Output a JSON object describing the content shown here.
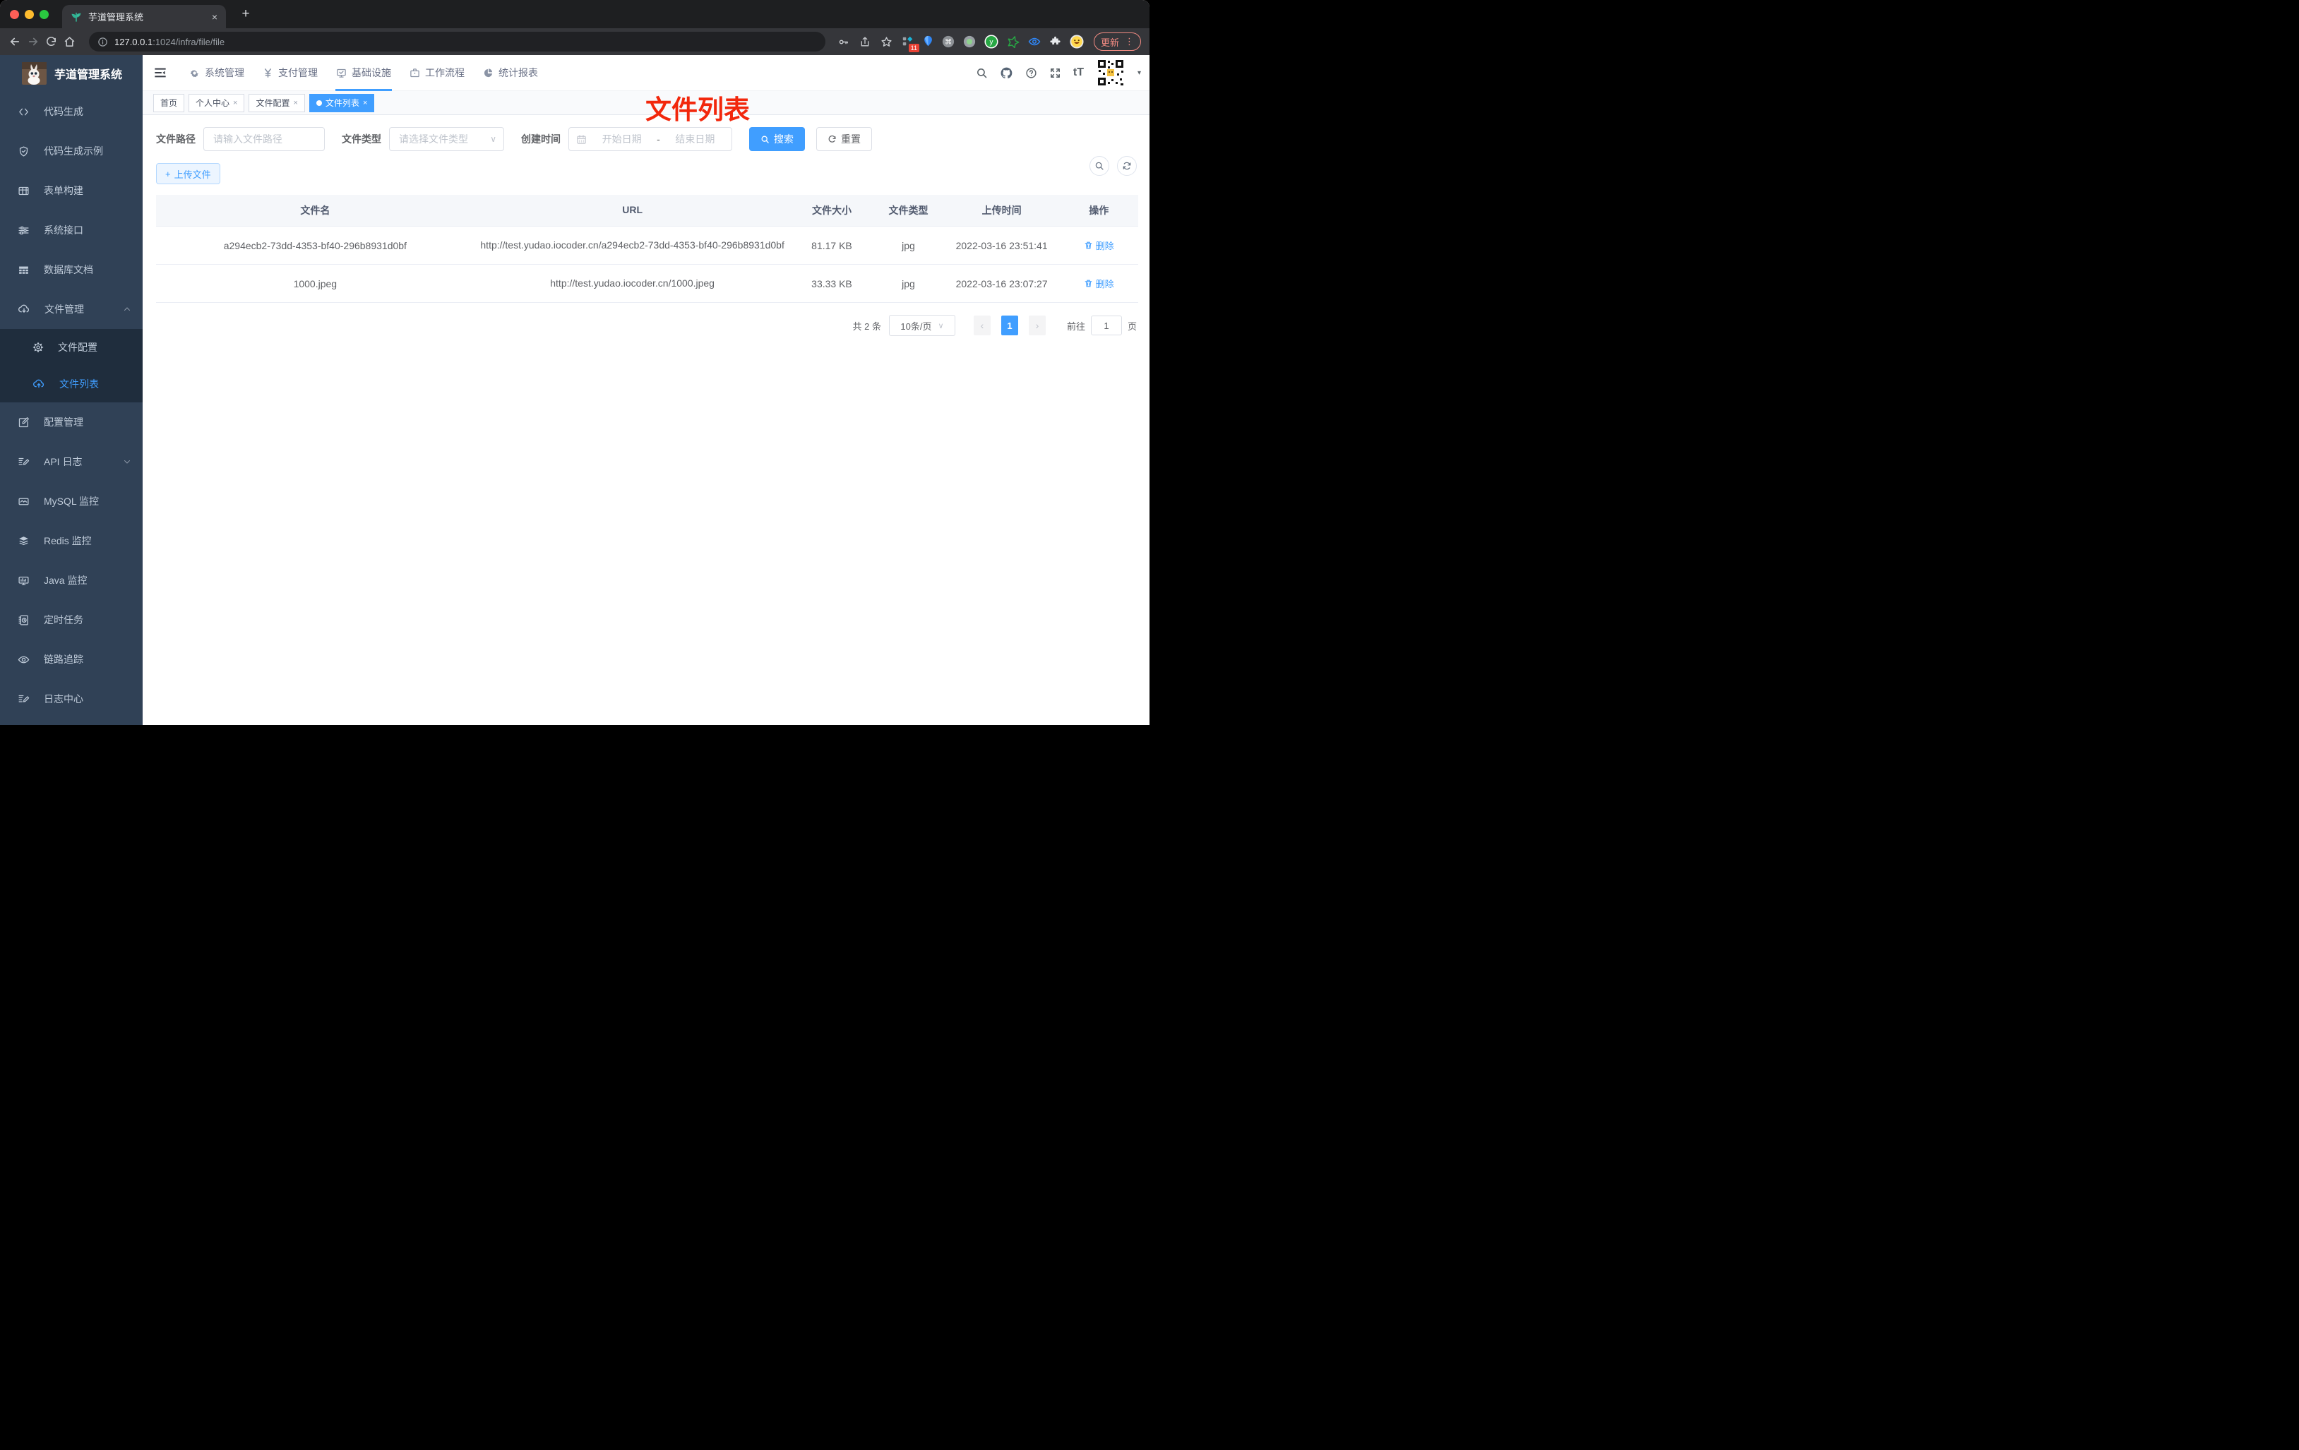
{
  "colors": {
    "accent": "#409eff",
    "annotation_red": "#f2270c",
    "update_pink": "#f28b82",
    "sidebar_bg": "#304156",
    "submenu_bg": "#1f2d3d"
  },
  "icons": {
    "close": "×",
    "plus": "+",
    "ellipsis": "⋮",
    "caret_down": "▾",
    "chevron_down": "∨",
    "chevron_up": "∧",
    "dash": "-",
    "prev": "‹",
    "next": "›",
    "font_size": "tT",
    "cmd": "⌘",
    "y_letter": "y"
  },
  "browser": {
    "tab_title": "芋道管理系统",
    "url_host": "127.0.0.1",
    "url_rest": ":1024/infra/file/file",
    "update_label": "更新",
    "extension_badge": "11"
  },
  "sidebar": {
    "logo_title": "芋道管理系统",
    "items": [
      {
        "label": "代码生成"
      },
      {
        "label": "代码生成示例"
      },
      {
        "label": "表单构建"
      },
      {
        "label": "系统接口"
      },
      {
        "label": "数据库文档"
      },
      {
        "label": "文件管理"
      },
      {
        "label": "文件配置"
      },
      {
        "label": "文件列表"
      },
      {
        "label": "配置管理"
      },
      {
        "label": "API 日志"
      },
      {
        "label": "MySQL 监控"
      },
      {
        "label": "Redis 监控"
      },
      {
        "label": "Java 监控"
      },
      {
        "label": "定时任务"
      },
      {
        "label": "链路追踪"
      },
      {
        "label": "日志中心"
      }
    ]
  },
  "header": {
    "nav": [
      {
        "label": "系统管理"
      },
      {
        "label": "支付管理"
      },
      {
        "label": "基础设施"
      },
      {
        "label": "工作流程"
      },
      {
        "label": "统计报表"
      }
    ]
  },
  "tags": {
    "items": [
      {
        "label": "首页"
      },
      {
        "label": "个人中心"
      },
      {
        "label": "文件配置"
      },
      {
        "label": "文件列表"
      }
    ]
  },
  "annotation": {
    "text": "文件列表"
  },
  "filters": {
    "path_label": "文件路径",
    "path_placeholder": "请输入文件路径",
    "type_label": "文件类型",
    "type_placeholder": "请选择文件类型",
    "time_label": "创建时间",
    "start_placeholder": "开始日期",
    "end_placeholder": "结束日期",
    "search_label": "搜索",
    "reset_label": "重置"
  },
  "toolbar": {
    "upload_label": "上传文件"
  },
  "table": {
    "headers": [
      "文件名",
      "URL",
      "文件大小",
      "文件类型",
      "上传时间",
      "操作"
    ],
    "rows": [
      {
        "name": "a294ecb2-73dd-4353-bf40-296b8931d0bf",
        "url": "http://test.yudao.iocoder.cn/a294ecb2-73dd-4353-bf40-296b8931d0bf",
        "size": "81.17 KB",
        "type": "jpg",
        "time": "2022-03-16 23:51:41",
        "action": "删除"
      },
      {
        "name": "1000.jpeg",
        "url": "http://test.yudao.iocoder.cn/1000.jpeg",
        "size": "33.33 KB",
        "type": "jpg",
        "time": "2022-03-16 23:07:27",
        "action": "删除"
      }
    ]
  },
  "pagination": {
    "total": "共 2 条",
    "page_size": "10条/页",
    "page": "1",
    "goto_label": "前往",
    "goto_value": "1",
    "page_suffix": "页"
  }
}
